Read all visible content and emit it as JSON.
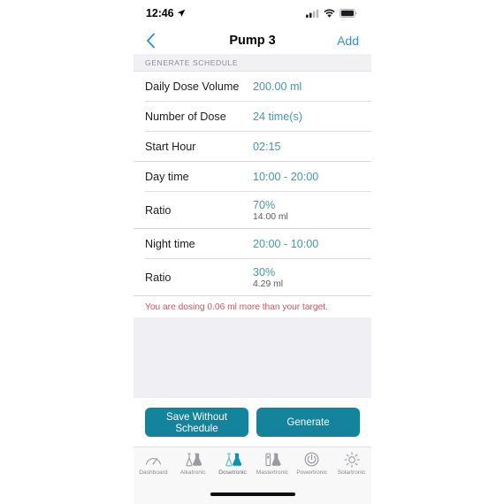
{
  "status_bar": {
    "time": "12:46",
    "location_icon": "location-arrow-icon",
    "cellular_icon": "cellular-signal-icon",
    "wifi_icon": "wifi-icon",
    "battery_icon": "battery-full-icon"
  },
  "nav_bar": {
    "back_icon": "chevron-left-icon",
    "title": "Pump 3",
    "add_label": "Add"
  },
  "section": {
    "header": "GENERATE SCHEDULE"
  },
  "rows": [
    {
      "label": "Daily Dose Volume",
      "value": "200.00 ml",
      "sub": ""
    },
    {
      "label": "Number of Dose",
      "value": "24 time(s)",
      "sub": ""
    },
    {
      "label": "Start Hour",
      "value": "02:15",
      "sub": ""
    },
    {
      "label": "Day time",
      "value": "10:00 - 20:00",
      "sub": ""
    },
    {
      "label": "Ratio",
      "value": "70%",
      "sub": "14.00 ml"
    },
    {
      "label": "Night time",
      "value": "20:00 - 10:00",
      "sub": ""
    },
    {
      "label": "Ratio",
      "value": "30%",
      "sub": "4.29 ml"
    }
  ],
  "warning": {
    "text": "You are dosing 0.06 ml more than your target."
  },
  "actions": {
    "save_label": "Save Without Schedule",
    "generate_label": "Generate"
  },
  "tab_bar": {
    "items": [
      {
        "label": "Dashboard",
        "icon": "gauge-icon",
        "active": false
      },
      {
        "label": "Alkatronic",
        "icon": "flask-icon",
        "active": false
      },
      {
        "label": "Dosetronic",
        "icon": "flask-filled-icon",
        "active": true
      },
      {
        "label": "Mastertronic",
        "icon": "flask-bottle-icon",
        "active": false
      },
      {
        "label": "Powertronic",
        "icon": "power-icon",
        "active": false
      },
      {
        "label": "Solartronic",
        "icon": "sun-icon",
        "active": false
      }
    ]
  },
  "colors": {
    "accent_teal": "#13849c",
    "value_teal": "#3e9aad",
    "link_blue": "#2f8fdd",
    "warning_red": "#e0505f",
    "panel_gray": "#f0eff4",
    "section_gray": "#f1f1f4"
  }
}
